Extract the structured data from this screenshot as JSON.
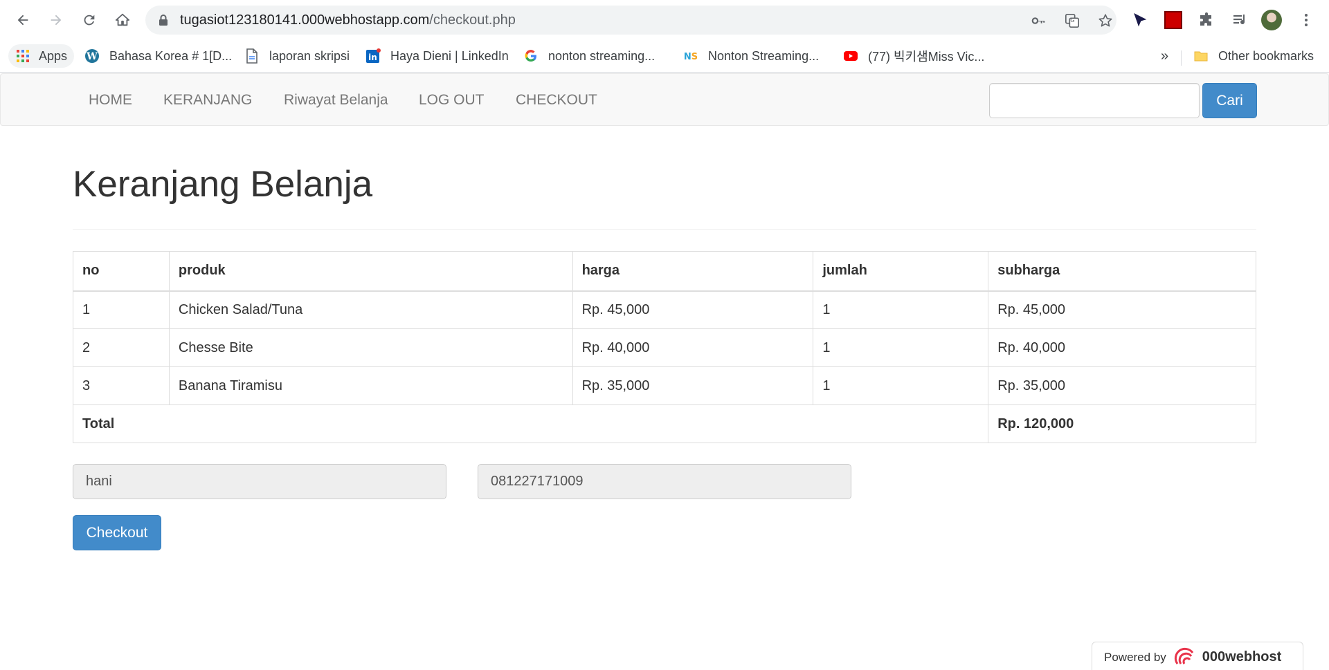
{
  "browser": {
    "url_host": "tugasiot123180141.000webhostapp.com",
    "url_path": "/checkout.php",
    "bookmarks": [
      {
        "label": "Apps",
        "icon": "apps-grid-icon"
      },
      {
        "label": "Bahasa Korea # 1[D...",
        "icon": "wordpress-icon"
      },
      {
        "label": "laporan skripsi",
        "icon": "document-icon"
      },
      {
        "label": "Haya Dieni | LinkedIn",
        "icon": "linkedin-icon"
      },
      {
        "label": "nonton streaming...",
        "icon": "google-icon"
      },
      {
        "label": "Nonton Streaming...",
        "icon": "ns-icon"
      },
      {
        "label": "(77) 빅키샘Miss Vic...",
        "icon": "youtube-icon"
      }
    ],
    "overflow_label": "»",
    "other_bookmarks": "Other bookmarks"
  },
  "navbar": {
    "links": [
      "HOME",
      "KERANJANG",
      "Riwayat Belanja",
      "LOG OUT",
      "CHECKOUT"
    ],
    "search_placeholder": "",
    "search_button": "Cari"
  },
  "main": {
    "title": "Keranjang Belanja",
    "table": {
      "headers": [
        "no",
        "produk",
        "harga",
        "jumlah",
        "subharga"
      ],
      "rows": [
        [
          "1",
          "Chicken Salad/Tuna",
          "Rp. 45,000",
          "1",
          "Rp. 45,000"
        ],
        [
          "2",
          "Chesse Bite",
          "Rp. 40,000",
          "1",
          "Rp. 40,000"
        ],
        [
          "3",
          "Banana Tiramisu",
          "Rp. 35,000",
          "1",
          "Rp. 35,000"
        ]
      ],
      "total_label": "Total",
      "total_value": "Rp. 120,000"
    },
    "name_value": "hani",
    "phone_value": "081227171009",
    "checkout_button": "Checkout"
  },
  "footer": {
    "powered_by": "Powered by",
    "brand": "000webhost"
  },
  "colors": {
    "primary": "#428bca",
    "navbar_bg": "#f8f8f8",
    "readonly_bg": "#eeeeee"
  }
}
